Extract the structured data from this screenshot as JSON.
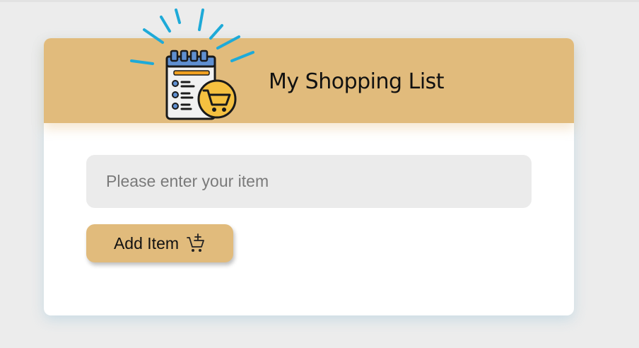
{
  "app": {
    "title": "My Shopping List"
  },
  "header": {
    "title": "My Shopping List",
    "icon": "shopping-list-cart-icon"
  },
  "form": {
    "input_placeholder": "Please enter your item",
    "input_value": "",
    "add_button_label": "Add Item",
    "add_button_icon": "cart-plus-icon"
  },
  "colors": {
    "page_background": "#ececec",
    "card_background": "#ffffff",
    "accent": "#e1bb7c",
    "input_background": "#ebebeb",
    "sparkle": "#1eaad8"
  }
}
